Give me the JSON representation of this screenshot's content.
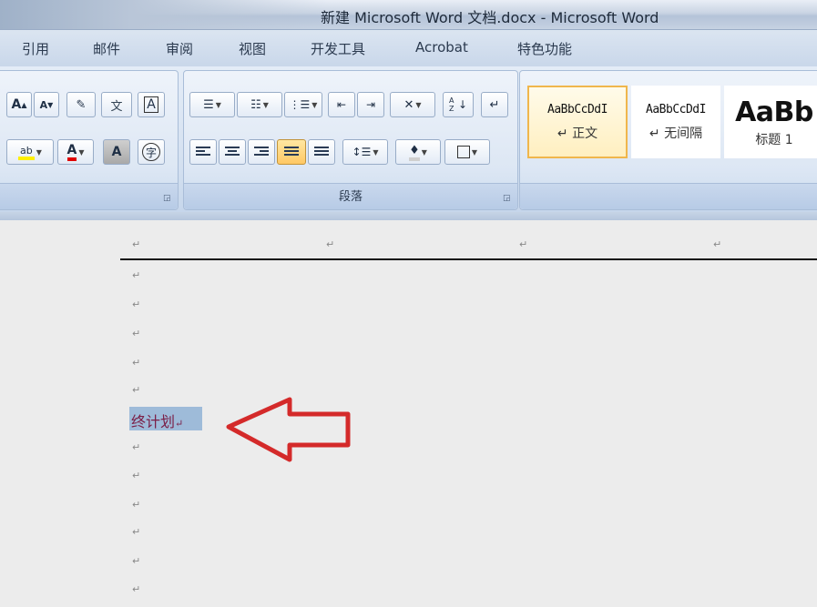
{
  "window": {
    "title": "新建 Microsoft Word 文档.docx - Microsoft Word"
  },
  "tabs": [
    "引用",
    "邮件",
    "审阅",
    "视图",
    "开发工具",
    "Acrobat",
    "特色功能"
  ],
  "ribbon": {
    "font_group": {
      "row1": [
        "A",
        "A"
      ],
      "color_letter": "A",
      "highlight_label": "ab",
      "char_border": "A",
      "enclose_char": "字"
    },
    "paragraph_group": {
      "label": "段落",
      "sort_label": "A Z"
    },
    "styles_group": {
      "styles": [
        {
          "preview": "AaBbCcDdI",
          "name": "↵ 正文"
        },
        {
          "preview": "AaBbCcDdI",
          "name": "↵ 无间隔"
        },
        {
          "preview": "AaBb",
          "name": "标题 1"
        }
      ]
    }
  },
  "document": {
    "paragraph_mark": "↵",
    "selected_text": "终计划",
    "colors": {
      "selection": "#9ebbd9",
      "text": "#7b1e46",
      "arrow": "#d42a2a"
    }
  }
}
